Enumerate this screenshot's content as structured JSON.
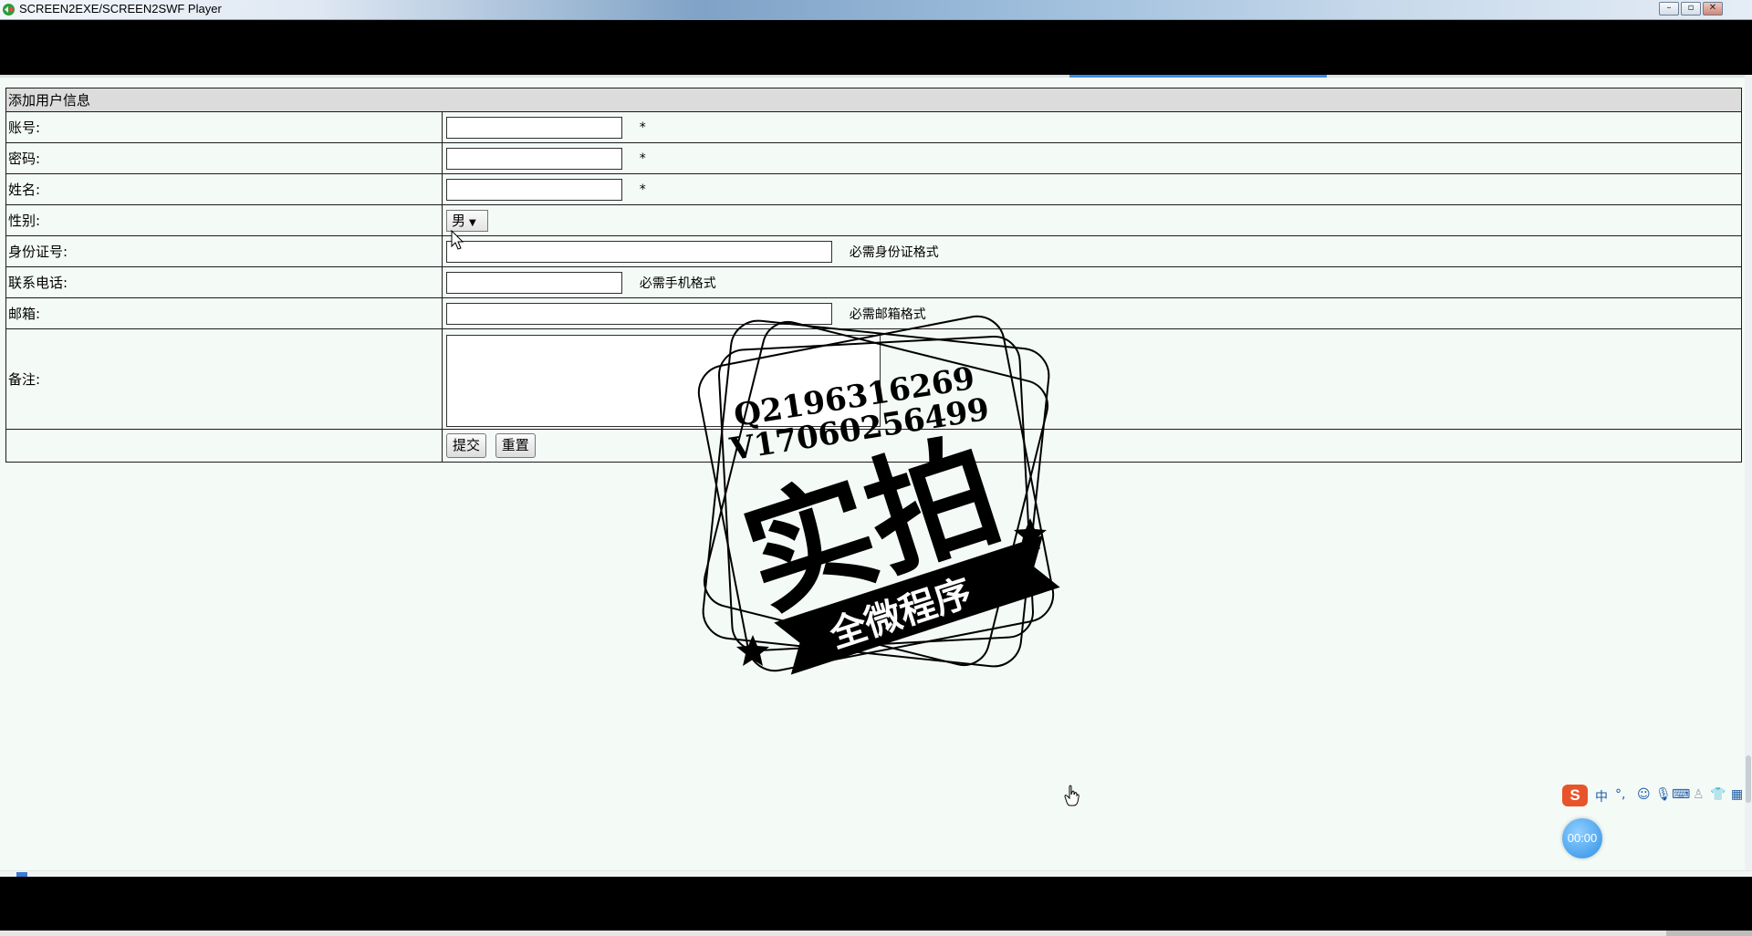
{
  "window": {
    "title": "SCREEN2EXE/SCREEN2SWF Player"
  },
  "form": {
    "header": "添加用户信息",
    "fields": {
      "account": {
        "label": "账号:",
        "value": "",
        "required_mark": "*"
      },
      "password": {
        "label": "密码:",
        "value": "",
        "required_mark": "*"
      },
      "name": {
        "label": "姓名:",
        "value": "",
        "required_mark": "*"
      },
      "gender": {
        "label": "性别:",
        "selected": "男"
      },
      "id_card": {
        "label": "身份证号:",
        "value": "",
        "hint": "必需身份证格式"
      },
      "phone": {
        "label": "联系电话:",
        "value": "",
        "hint": "必需手机格式"
      },
      "email": {
        "label": "邮箱:",
        "value": "",
        "hint": "必需邮箱格式"
      },
      "remark": {
        "label": "备注:",
        "value": ""
      }
    },
    "buttons": {
      "submit": "提交",
      "reset": "重置"
    }
  },
  "watermark": {
    "line1": "Q2196316269",
    "line2": "V17060256499",
    "main": "实拍",
    "banner": "全微程序"
  },
  "ime": {
    "lang": "中",
    "punct": "°,",
    "timer": "00:00"
  },
  "colors": {
    "page_bg": "#f4fbf7",
    "header_bg": "#dcdcdc",
    "tab_accent": "#3a8ee0",
    "ime_logo": "#e8542a"
  }
}
